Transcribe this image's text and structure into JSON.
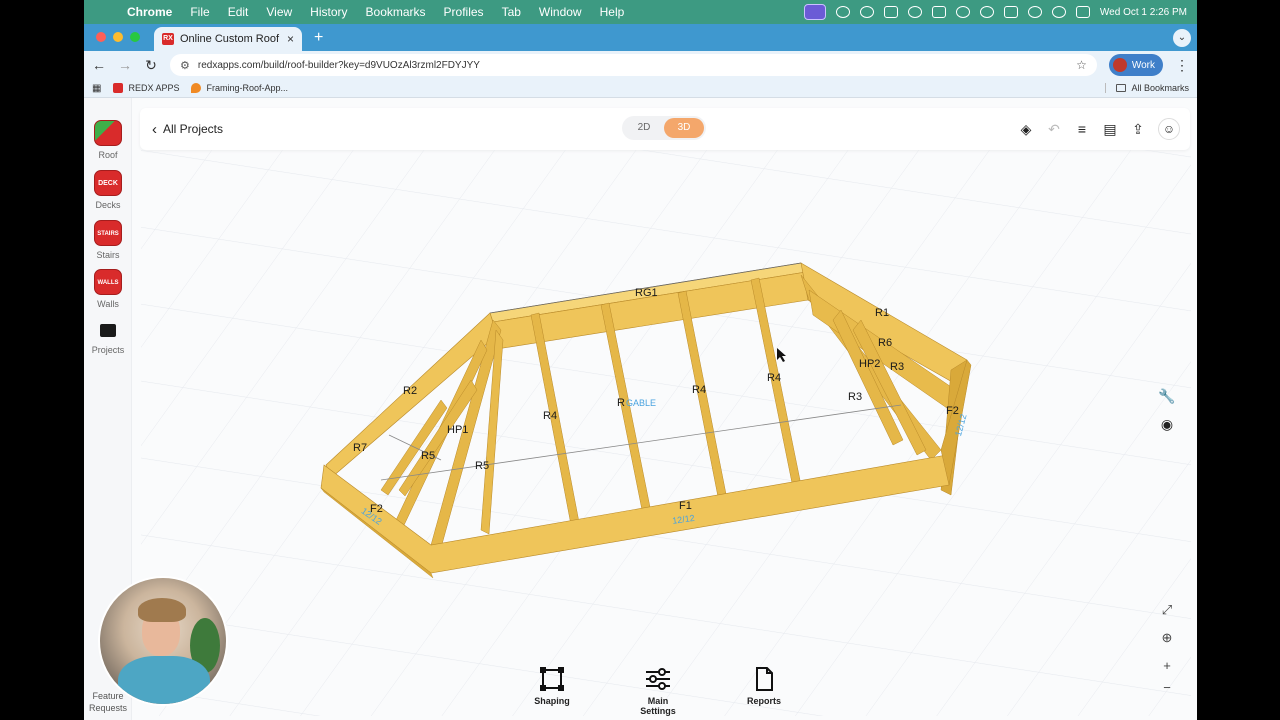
{
  "menubar": {
    "app": "Chrome",
    "items": [
      "File",
      "Edit",
      "View",
      "History",
      "Bookmarks",
      "Profiles",
      "Tab",
      "Window",
      "Help"
    ],
    "clock": "Wed Oct 1  2:26 PM"
  },
  "browser": {
    "tab_title": "Online Custom Roof Builder",
    "url": "redxapps.com/build/roof-builder?key=d9VUOzAl3rzml2FDYJYY",
    "profile": "Work",
    "bookmarks": [
      "REDX APPS",
      "Framing-Roof-App..."
    ],
    "all_bookmarks": "All Bookmarks"
  },
  "sidebar": {
    "items": [
      {
        "label": "Roof",
        "icon": "roof-icon",
        "badge": ""
      },
      {
        "label": "Decks",
        "icon": "deck-icon",
        "badge": "DECK"
      },
      {
        "label": "Stairs",
        "icon": "stairs-icon",
        "badge": "STAIRS"
      },
      {
        "label": "Walls",
        "icon": "walls-icon",
        "badge": "WALLS"
      },
      {
        "label": "Projects",
        "icon": "folder-icon",
        "badge": ""
      }
    ],
    "feature_requests": "Feature Requests"
  },
  "header": {
    "back_label": "All Projects",
    "view_toggle": {
      "option_2d": "2D",
      "option_3d": "3D",
      "selected": "3D"
    }
  },
  "model_labels": {
    "rg1": "RG1",
    "r1": "R1",
    "r6": "R6",
    "hp2": "HP2",
    "r3a": "R3",
    "r3b": "R3",
    "f2_right": "F2",
    "pitch_right": "12/12",
    "r2": "R2",
    "r7": "R7",
    "hp1": "HP1",
    "r5a": "R5",
    "r5b": "R5",
    "r4a": "R4",
    "r4b": "R4",
    "r4c": "R4",
    "r_partial": "R",
    "gable": "GABLE",
    "f1": "F1",
    "pitch_front": "12/12",
    "f2_left": "F2",
    "pitch_left": "12/12"
  },
  "bottom_toolbar": {
    "shaping": "Shaping",
    "main_settings": "Main Settings",
    "reports": "Reports"
  },
  "colors": {
    "lumber": "#efc55a",
    "lumber_dark": "#d9a93a",
    "accent_orange": "#f4a76b",
    "label_blue": "#4aa3df",
    "tab_bar": "#3f98cf",
    "menu_bar": "#3d9a82"
  }
}
